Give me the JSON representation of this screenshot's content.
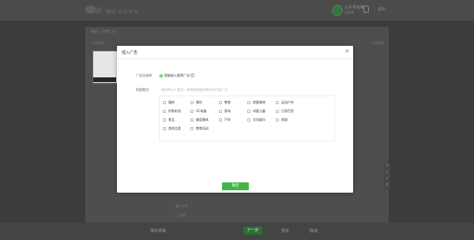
{
  "app": {
    "logo_text": "微信·公众平台",
    "user_name": "公众号名称",
    "user_sub": "运营者",
    "exit_label": "退出"
  },
  "background": {
    "breadcrumb": "流量主 › 投放广告",
    "left_label": "广告样式",
    "right_label": "广告预览",
    "side_tools": [
      "样",
      "式",
      "反",
      "馈"
    ],
    "text_1": "展示方式",
    "text_2": "○ 全部",
    "bottom_left": "保存草稿",
    "bottom_button": "下一步",
    "bottom_mid_1": "预览",
    "bottom_mid_2": "取消"
  },
  "modal": {
    "title": "插入广告",
    "close_icon": "×",
    "row1_label": "广告位选择",
    "radio_label": "智能插入推荐广告",
    "help_icon": "?",
    "row2_label": "投放类目",
    "hint": "请选择以下类目，系统将根据选择自动匹配广告",
    "categories": [
      [
        "服饰",
        "餐饮",
        "教育",
        "房屋装修",
        "运动户外"
      ],
      [
        "护肤彩妆",
        "3C电器",
        "家电",
        "母婴儿童",
        "日用百货"
      ],
      [
        "食品",
        "美容美体",
        "汽车",
        "文化娱乐",
        "旅游"
      ],
      [
        "其他品类",
        "教育培训"
      ]
    ],
    "confirm_label": "确定"
  },
  "colors": {
    "accent": "#44b549",
    "overlay": "#3b3d3b"
  }
}
